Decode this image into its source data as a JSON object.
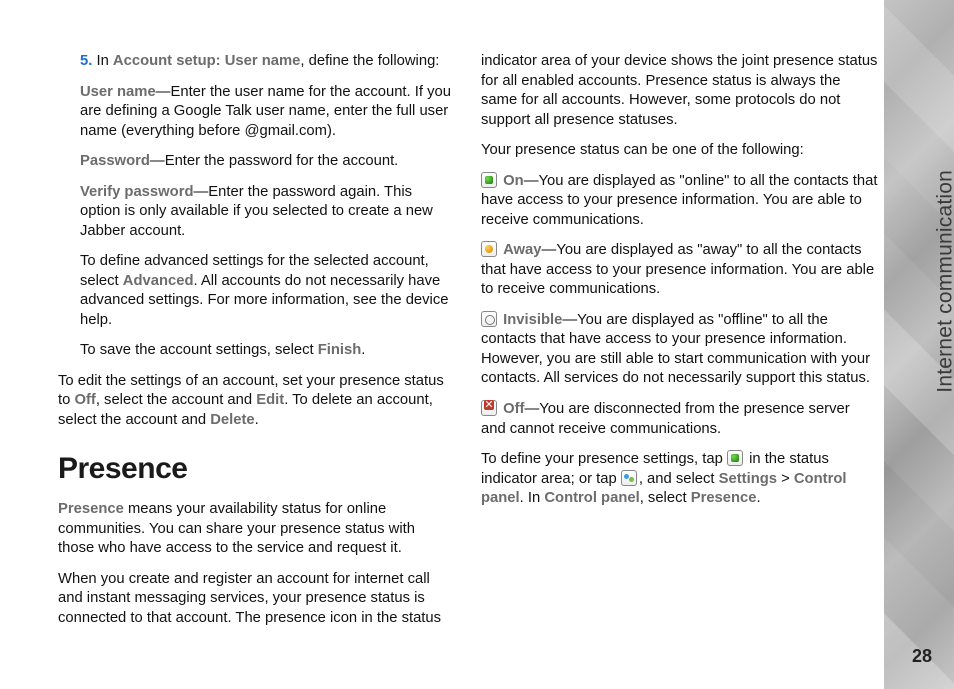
{
  "sidebar": {
    "chapter": "Internet communication",
    "page_number": "28"
  },
  "left": {
    "step_num": "5.",
    "step_intro_a": "In ",
    "step_intro_b": "Account setup: User name",
    "step_intro_c": ", define the following:",
    "username_label": "User name",
    "username_text": "—Enter the user name for the account. If you are defining a Google Talk user name, enter the full user name (everything before @gmail.com).",
    "password_label": "Password",
    "password_text": "—Enter the password for the account.",
    "verify_label": "Verify password",
    "verify_text": "—Enter the password again. This option is only available if you selected to create a new Jabber account.",
    "adv_a": "To define advanced settings for the selected account, select ",
    "adv_b": "Advanced",
    "adv_c": ". All accounts do not necessarily have advanced settings. For more information, see the device help.",
    "save_a": "To save the account settings, select ",
    "save_b": "Finish",
    "save_c": ".",
    "edit_a": "To edit the settings of an account, set your presence status to ",
    "edit_off": "Off",
    "edit_b": ", select the account and ",
    "edit_edit": "Edit",
    "edit_c": ". To delete an account, select the account and ",
    "edit_delete": "Delete",
    "edit_d": ".",
    "presence_heading": "Presence",
    "presence_label": "Presence",
    "presence_text": " means your availability status for online communities. You can share your presence status with those who have access to the service and request it.",
    "presence_para2": "When you create and register an account for internet call and instant messaging services, your presence status is connected to that account. The presence icon in the status"
  },
  "right": {
    "cont1": "indicator area of your device shows the joint presence status for all enabled accounts. Presence status is always the same for all accounts. However, some protocols do not support all presence statuses.",
    "intro2": "Your presence status can be one of the following:",
    "on_label": "On",
    "on_text": "—You are displayed as \"online\" to all the contacts that have access to your presence information. You are able to receive communications.",
    "away_label": "Away",
    "away_text": "—You are displayed as \"away\" to all the contacts that have access to your presence information. You are able to receive communications.",
    "inv_label": "Invisible",
    "inv_text": "—You are displayed as \"offline\" to all the contacts that have access to your presence information. However, you are still able to start communication with your contacts. All services do not necessarily support this status.",
    "off_label": "Off",
    "off_text": "—You are disconnected from the presence server and cannot receive communications.",
    "def_a": "To define your presence settings, tap ",
    "def_b": " in the status indicator area; or tap ",
    "def_c": ", and select ",
    "def_settings": "Settings",
    "def_gt": " > ",
    "def_cp1": "Control panel",
    "def_d": ". In ",
    "def_cp2": "Control panel",
    "def_e": ", select ",
    "def_presence": "Presence",
    "def_f": "."
  }
}
